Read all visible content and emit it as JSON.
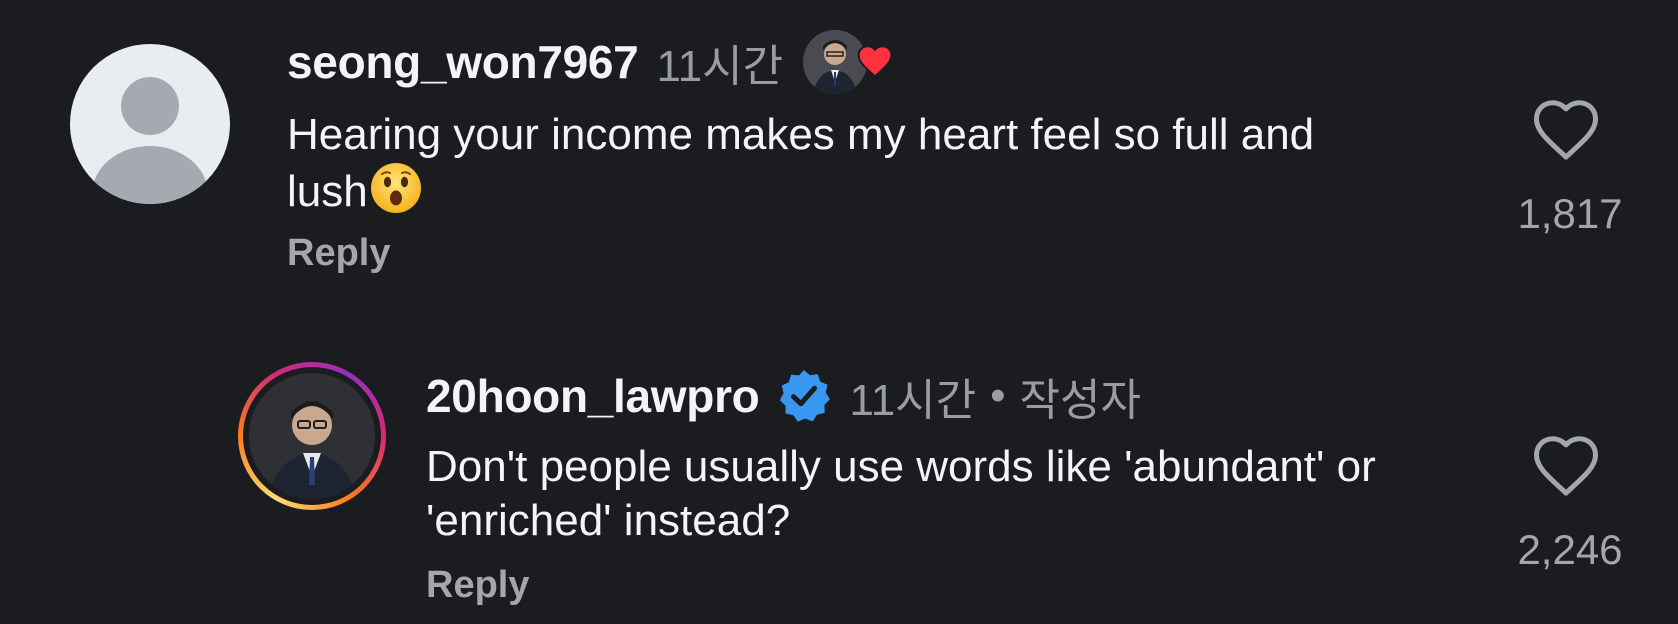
{
  "comments": [
    {
      "username": "seong_won7967",
      "time": "11시간",
      "text": "Hearing your income makes my heart feel so full and lush",
      "emoji_icon": "astonished-face-emoji",
      "reply_label": "Reply",
      "like_count": "1,817",
      "liked_by_creator": true
    },
    {
      "username": "20hoon_lawpro",
      "verified": true,
      "time": "11시간",
      "separator": "•",
      "author_label": "작성자",
      "text": "Don't people usually use words like 'abundant' or 'enriched' instead?",
      "reply_label": "Reply",
      "like_count": "2,246"
    }
  ],
  "colors": {
    "background": "#1b1c20",
    "primary_text": "#f4f4f6",
    "secondary_text": "#9a9ca3",
    "verified_blue": "#3897f0",
    "heart_red": "#ff3040"
  }
}
